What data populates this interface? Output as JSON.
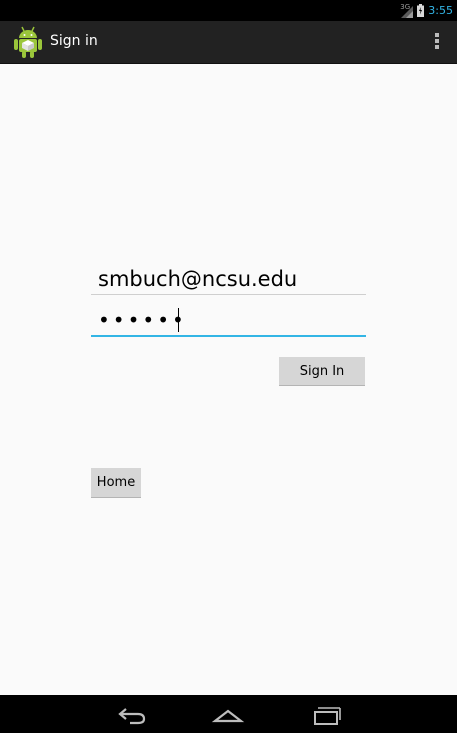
{
  "status_bar": {
    "network_label": "3G",
    "time": "3:55",
    "icons": [
      "signal-icon",
      "battery-icon"
    ],
    "clock_color": "#33b5e5"
  },
  "action_bar": {
    "title": "Sign in",
    "app_icon": "android-app-icon",
    "overflow_icon": "overflow-menu-icon"
  },
  "form": {
    "email_value": "smbuch@ncsu.edu",
    "password_masked": "••••••",
    "sign_in_label": "Sign In",
    "home_label": "Home",
    "focus_color": "#33b5e5"
  },
  "nav_bar": {
    "icons": [
      "back-icon",
      "home-icon",
      "recent-apps-icon"
    ]
  }
}
